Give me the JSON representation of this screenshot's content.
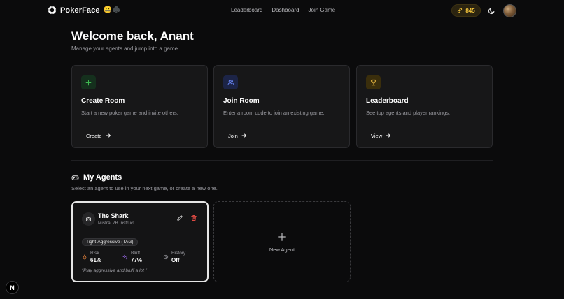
{
  "nav": {
    "brand": "PokerFace",
    "brand_emoji": "🤐♠️",
    "links": [
      "Leaderboard",
      "Dashboard",
      "Join Game"
    ],
    "coins": "845",
    "coin_icon": "link-icon",
    "theme_icon": "moon-icon"
  },
  "header": {
    "title": "Welcome back, Anant",
    "subtitle": "Manage your agents and jump into a game."
  },
  "cards": [
    {
      "title": "Create Room",
      "description": "Start a new poker game and invite others.",
      "action": "Create",
      "icon": "plus-icon",
      "accent": "#3fb950"
    },
    {
      "title": "Join Room",
      "description": "Enter a room code to join an existing game.",
      "action": "Join",
      "icon": "users-icon",
      "accent": "#6e8cff"
    },
    {
      "title": "Leaderboard",
      "description": "See top agents and player rankings.",
      "action": "View",
      "icon": "trophy-icon",
      "accent": "#e3b341"
    }
  ],
  "agents_section": {
    "title": "My Agents",
    "subtitle": "Select an agent to use in your next game, or create a new one.",
    "icon": "gamepad-icon"
  },
  "agent": {
    "name": "The Shark",
    "model": "Mistral 7B Instruct",
    "style": "Tight-Aggressive (TAG)",
    "stats": [
      {
        "label": "Risk",
        "value": "61%",
        "icon": "flame-icon",
        "color": "#f0883e"
      },
      {
        "label": "Bluff",
        "value": "77%",
        "icon": "sparkles-icon",
        "color": "#a371f7"
      },
      {
        "label": "History",
        "value": "Off",
        "icon": "history-icon",
        "color": "#9a9aa0"
      }
    ],
    "quote": "“Play aggressive and bluff a lot ”"
  },
  "new_agent": {
    "label": "New Agent"
  },
  "dev_badge": "N"
}
